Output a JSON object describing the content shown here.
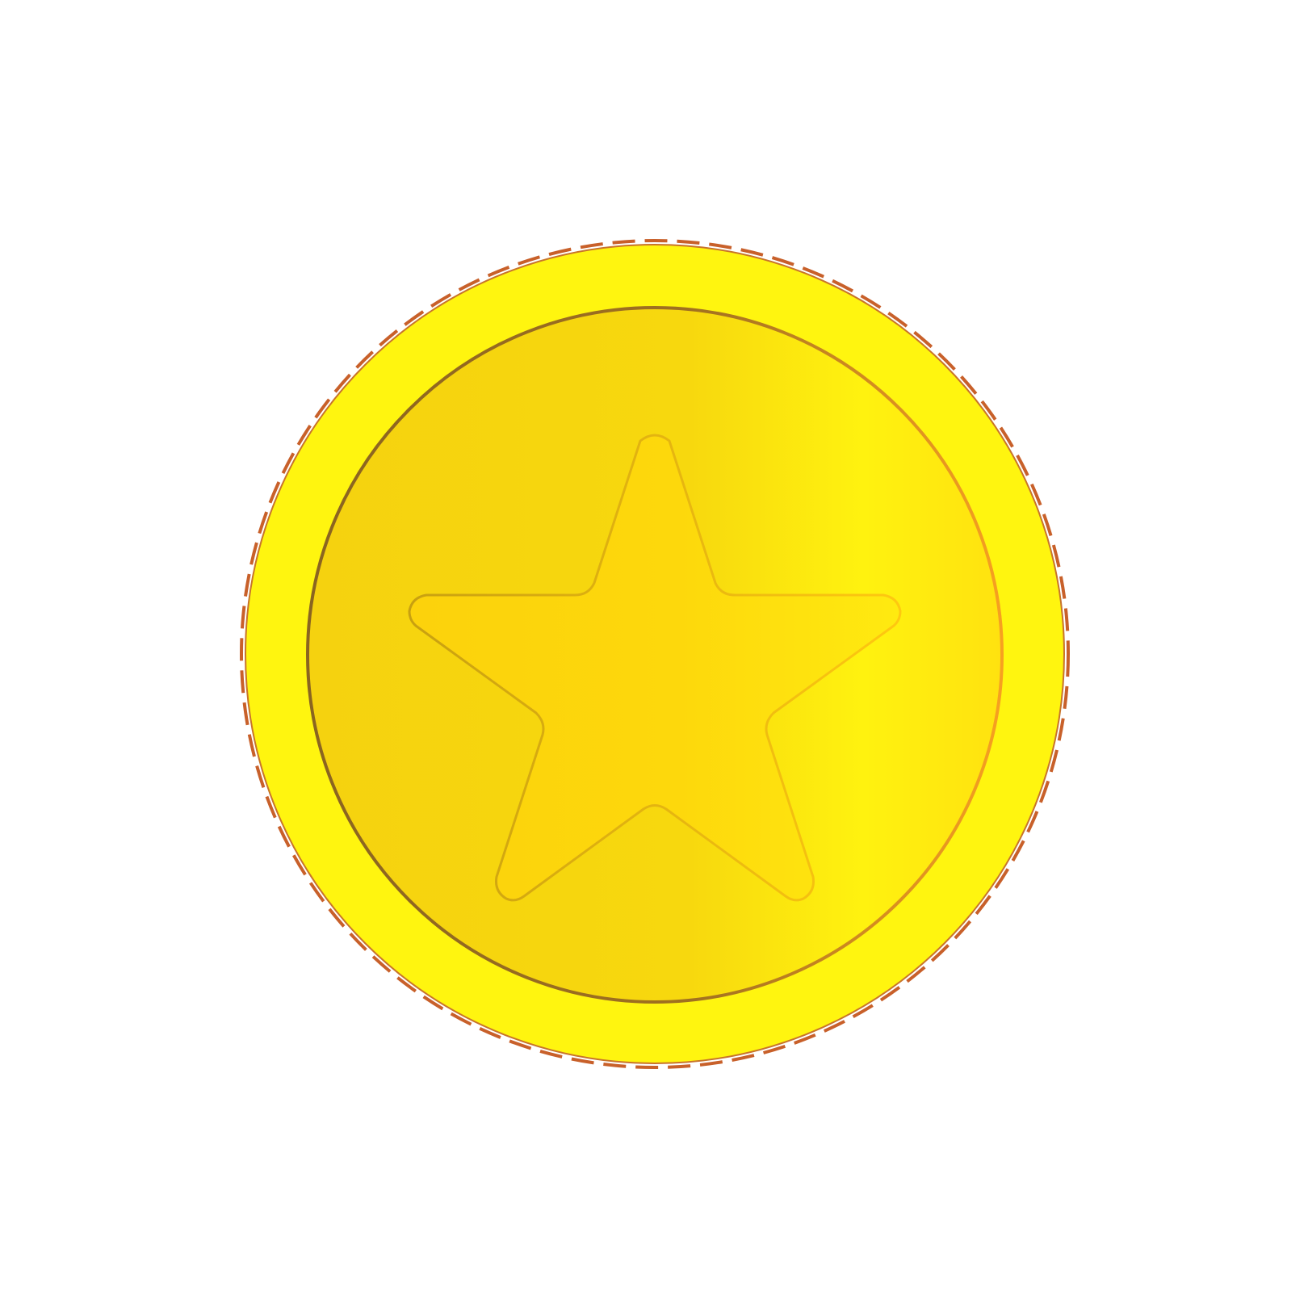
{
  "image": {
    "subject": "gold-coin-with-star",
    "colors": {
      "background": "#ffffff",
      "rim_fill": "#fff50f",
      "rim_outline": "#c8742a",
      "rim_edge_dash": "#c8602a",
      "face_fill_left": "#f5d20f",
      "face_fill_mid": "#f7d80e",
      "face_fill_right": "#fff20f",
      "face_ring_left": "#8a6420",
      "face_ring_right": "#f7a020",
      "star_fill_left": "#fcd20c",
      "star_fill_right": "#ffea10",
      "star_outline_left": "#c8a010",
      "star_outline_right": "#ffc810"
    },
    "icons": {
      "coin": "coin-icon",
      "star": "star-icon"
    }
  }
}
